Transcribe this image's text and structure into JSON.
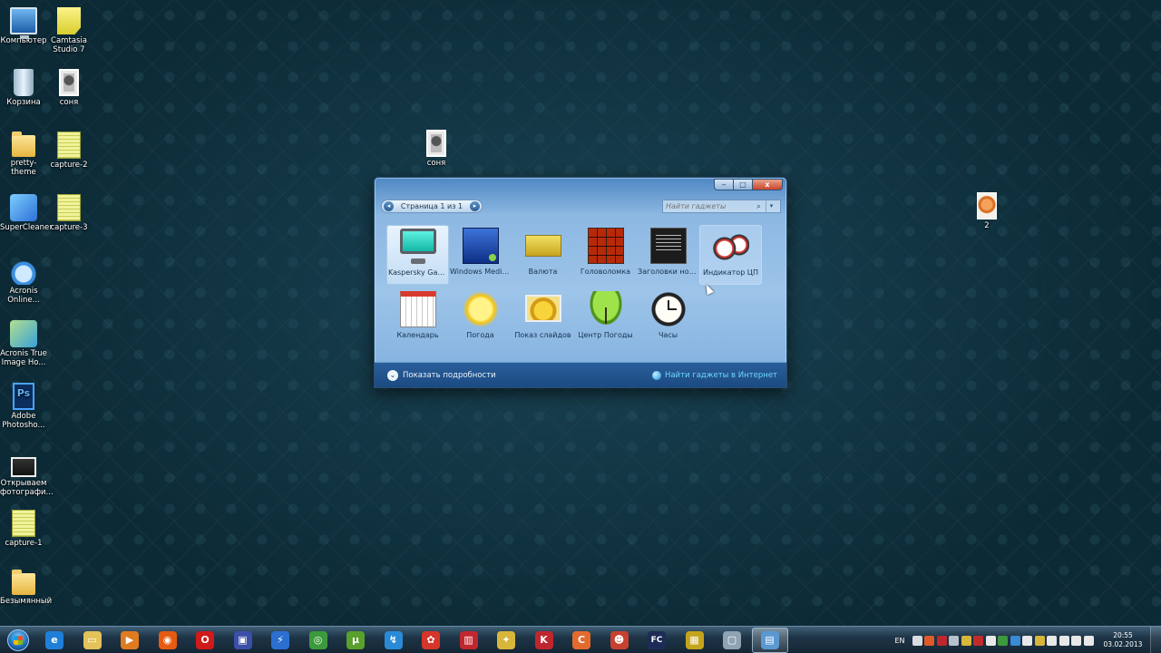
{
  "desktop": {
    "icons": [
      {
        "label": "Компьютер",
        "icon": "computer-icon"
      },
      {
        "label": "Camtasia Studio 7",
        "icon": "camtasia-icon"
      },
      {
        "label": "Корзина",
        "icon": "recycle-bin-icon"
      },
      {
        "label": "соня",
        "icon": "photo-icon"
      },
      {
        "label": "pretty-theme",
        "icon": "folder-icon"
      },
      {
        "label": "capture-2",
        "icon": "video-file-icon"
      },
      {
        "label": "SuperCleaner",
        "icon": "supercleaner-icon"
      },
      {
        "label": "capture-3",
        "icon": "video-file-icon"
      },
      {
        "label": "Acronis Online...",
        "icon": "acronis-icon"
      },
      {
        "label": "Acronis True Image Ho...",
        "icon": "acronis-true-image-icon"
      },
      {
        "label": "Adobe Photosho...",
        "icon": "photoshop-icon"
      },
      {
        "label": "Открываем фотографи...",
        "icon": "video-file-icon"
      },
      {
        "label": "capture-1",
        "icon": "video-file-icon"
      },
      {
        "label": "Безымянный",
        "icon": "folder-icon"
      },
      {
        "label": "соня",
        "icon": "photo-icon"
      },
      {
        "label": "2",
        "icon": "photo-icon"
      }
    ]
  },
  "gadget_window": {
    "controls": {
      "minimize": "‒",
      "maximize": "□",
      "close": "x"
    },
    "pager_label": "Страница 1 из 1",
    "pager_prev": "◂",
    "pager_next": "▸",
    "search_placeholder": "Найти гаджеты",
    "search_icon_glyph": "⌕",
    "search_dropdown_glyph": "▾",
    "gadgets": [
      {
        "label": "Kaspersky Gadget",
        "icon": "kaspersky-gadget-icon"
      },
      {
        "label": "Windows Media...",
        "icon": "windows-media-center-icon"
      },
      {
        "label": "Валюта",
        "icon": "currency-icon"
      },
      {
        "label": "Головоломка",
        "icon": "puzzle-icon"
      },
      {
        "label": "Заголовки нов...",
        "icon": "news-headlines-icon"
      },
      {
        "label": "Индикатор ЦП",
        "icon": "cpu-meter-icon"
      },
      {
        "label": "Календарь",
        "icon": "calendar-icon"
      },
      {
        "label": "Погода",
        "icon": "weather-icon"
      },
      {
        "label": "Показ слайдов",
        "icon": "slideshow-icon"
      },
      {
        "label": "Центр Погоды",
        "icon": "weather-center-icon"
      },
      {
        "label": "Часы",
        "icon": "clock-icon"
      }
    ],
    "footer": {
      "details_label": "Показать подробности",
      "details_glyph": "⌄",
      "online_label": "Найти гаджеты в Интернет"
    }
  },
  "taskbar": {
    "apps": [
      {
        "name": "internet-explorer",
        "glyph": "e",
        "color": "#1f7fd8"
      },
      {
        "name": "explorer",
        "glyph": "▭",
        "color": "#e3c25a"
      },
      {
        "name": "media-player",
        "glyph": "▶",
        "color": "#e07b1f"
      },
      {
        "name": "firefox",
        "glyph": "◉",
        "color": "#e55b13"
      },
      {
        "name": "opera",
        "glyph": "O",
        "color": "#d01a1a"
      },
      {
        "name": "save-tool",
        "glyph": "▣",
        "color": "#3b4fa8"
      },
      {
        "name": "speed-tool",
        "glyph": "⚡",
        "color": "#2b6fd1"
      },
      {
        "name": "chrome",
        "glyph": "◎",
        "color": "#3c9a3c"
      },
      {
        "name": "utorrent",
        "glyph": "µ",
        "color": "#5aa02c"
      },
      {
        "name": "network-tool",
        "glyph": "↯",
        "color": "#2a8ad6"
      },
      {
        "name": "icq",
        "glyph": "✿",
        "color": "#d6352a"
      },
      {
        "name": "winrar",
        "glyph": "▥",
        "color": "#c2262e"
      },
      {
        "name": "fences",
        "glyph": "✦",
        "color": "#d8b63a"
      },
      {
        "name": "kaspersky",
        "glyph": "K",
        "color": "#c0262e"
      },
      {
        "name": "ccleaner",
        "glyph": "C",
        "color": "#e26a2c"
      },
      {
        "name": "game-app",
        "glyph": "☻",
        "color": "#c8402e"
      },
      {
        "name": "far-manager",
        "glyph": "FC",
        "color": "#1d2c56"
      },
      {
        "name": "camtasia",
        "glyph": "▦",
        "color": "#c5a41c"
      },
      {
        "name": "window-app",
        "glyph": "▢",
        "color": "#8ea3b4"
      },
      {
        "name": "gadgets",
        "glyph": "▤",
        "color": "#5b98d2"
      }
    ],
    "language": "EN",
    "time": "20:55",
    "date": "03.02.2013",
    "tray_colors": [
      "#d9dde2",
      "#e05a28",
      "#c0262e",
      "#b6c2cc",
      "#d8b63a",
      "#c22b2b",
      "#e8e8e8",
      "#3c9a3c",
      "#3a8ad6",
      "#e8e8e8",
      "#d8b63a",
      "#e8e8e8",
      "#e8e8e8",
      "#e8e8e8",
      "#e8e8e8"
    ]
  }
}
